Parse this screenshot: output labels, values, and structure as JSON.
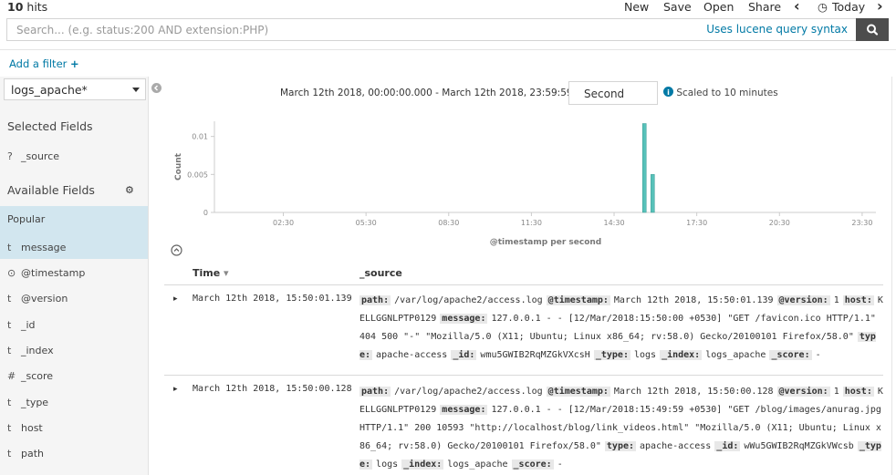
{
  "hits": {
    "count": "10",
    "label": "hits"
  },
  "topmenu": {
    "new": "New",
    "save": "Save",
    "open": "Open",
    "share": "Share",
    "prev": "‹",
    "clock": "◷",
    "timepicker": "Today",
    "next": "›"
  },
  "search": {
    "placeholder": "Search... (e.g. status:200 AND extension:PHP)",
    "lucene_link": "Uses lucene query syntax"
  },
  "filter": {
    "add_label": "Add a filter",
    "plus": "+"
  },
  "sidebar": {
    "index_pattern": "logs_apache*",
    "selected_title": "Selected Fields",
    "selected_fields": [
      {
        "type": "?",
        "name": "_source"
      }
    ],
    "available_title": "Available Fields",
    "popular_label": "Popular",
    "available_fields": [
      {
        "type": "t",
        "name": "message"
      },
      {
        "type": "⊙",
        "name": "@timestamp"
      },
      {
        "type": "t",
        "name": "@version"
      },
      {
        "type": "t",
        "name": "_id"
      },
      {
        "type": "t",
        "name": "_index"
      },
      {
        "type": "#",
        "name": "_score"
      },
      {
        "type": "t",
        "name": "_type"
      },
      {
        "type": "t",
        "name": "host"
      },
      {
        "type": "t",
        "name": "path"
      }
    ]
  },
  "histogram": {
    "date_range": "March 12th 2018, 00:00:00.000 - March 12th 2018, 23:59:59.999 —",
    "interval": "Second",
    "scaled_text": "Scaled to 10 minutes",
    "info_glyph": "i"
  },
  "chart_data": {
    "type": "bar",
    "xlabel": "@timestamp per second",
    "ylabel": "Count",
    "x_ticks": [
      "02:30",
      "05:30",
      "08:30",
      "11:30",
      "14:30",
      "17:30",
      "20:30",
      "23:30"
    ],
    "y_ticks": [
      "0",
      "0.005",
      "0.01"
    ],
    "ylim": [
      0,
      0.012
    ],
    "xlim_hours": [
      0,
      24
    ],
    "bars": [
      {
        "hour": 15.6,
        "value": 0.0117
      },
      {
        "hour": 15.9,
        "value": 0.005
      }
    ],
    "bar_color": "#57c1b9"
  },
  "table": {
    "time_header": "Time",
    "sort_glyph": "▾",
    "source_header": "_source",
    "rows": [
      {
        "time": "March 12th 2018, 15:50:01.139",
        "fields": [
          {
            "k": "path:",
            "v": "/var/log/apache2/access.log"
          },
          {
            "k": "@timestamp:",
            "v": "March 12th 2018, 15:50:01.139"
          },
          {
            "k": "@version:",
            "v": "1"
          },
          {
            "k": "host:",
            "v": "KELLGGNLPTP0129"
          },
          {
            "k": "message:",
            "v": "127.0.0.1 - - [12/Mar/2018:15:50:00 +0530] \"GET /favicon.ico HTTP/1.1\" 404 500 \"-\" \"Mozilla/5.0 (X11; Ubuntu; Linux x86_64; rv:58.0) Gecko/20100101 Firefox/58.0\""
          },
          {
            "k": "type:",
            "v": "apache-access"
          },
          {
            "k": "_id:",
            "v": "wmu5GWIB2RqMZGkVXcsH"
          },
          {
            "k": "_type:",
            "v": "logs"
          },
          {
            "k": "_index:",
            "v": "logs_apache"
          },
          {
            "k": "_score:",
            "v": "-"
          }
        ]
      },
      {
        "time": "March 12th 2018, 15:50:00.128",
        "fields": [
          {
            "k": "path:",
            "v": "/var/log/apache2/access.log"
          },
          {
            "k": "@timestamp:",
            "v": "March 12th 2018, 15:50:00.128"
          },
          {
            "k": "@version:",
            "v": "1"
          },
          {
            "k": "host:",
            "v": "KELLGGNLPTP0129"
          },
          {
            "k": "message:",
            "v": "127.0.0.1 - - [12/Mar/2018:15:49:59 +0530] \"GET /blog/images/anurag.jpg HTTP/1.1\" 200 10593 \"http://localhost/blog/link_videos.html\" \"Mozilla/5.0 (X11; Ubuntu; Linux x86_64; rv:58.0) Gecko/20100101 Firefox/58.0\""
          },
          {
            "k": "type:",
            "v": "apache-access"
          },
          {
            "k": "_id:",
            "v": "wWu5GWIB2RqMZGkVWcsb"
          },
          {
            "k": "_type:",
            "v": "logs"
          },
          {
            "k": "_index:",
            "v": "logs_apache"
          },
          {
            "k": "_score:",
            "v": "-"
          }
        ]
      }
    ]
  }
}
